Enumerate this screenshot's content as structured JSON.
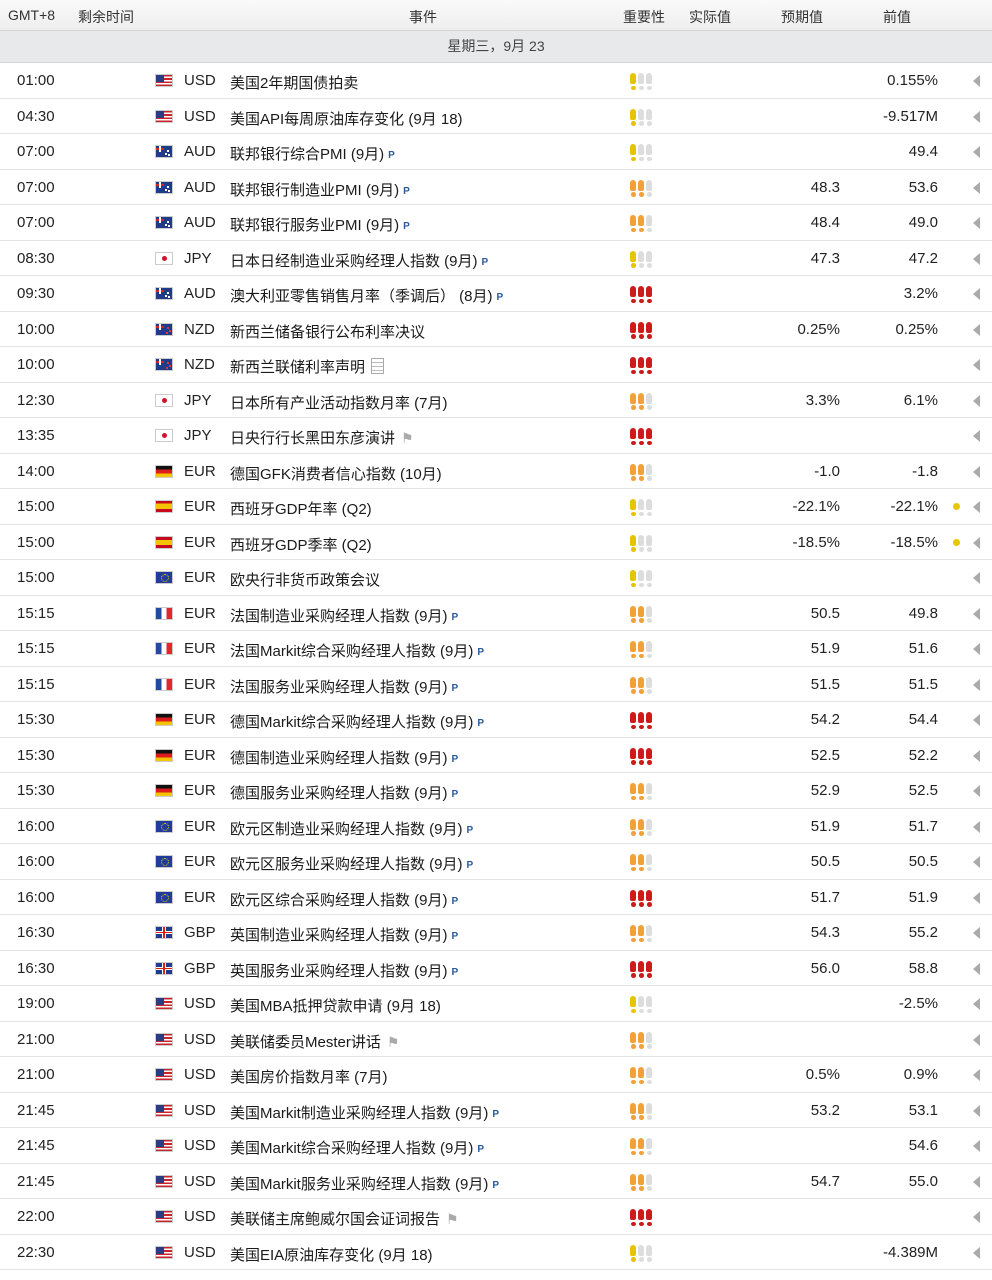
{
  "header": {
    "gmt": "GMT+8",
    "remaining": "剩余时间",
    "event": "事件",
    "importance": "重要性",
    "actual": "实际值",
    "forecast": "预期值",
    "previous": "前值"
  },
  "date": "星期三，9月 23",
  "colors": {
    "imp_low": "#e6c400",
    "imp_med": "#f0a13a",
    "imp_high": "#cc1b1b",
    "imp_empty": "#dddddd"
  },
  "rows": [
    {
      "time": "01:00",
      "flag": "us",
      "cur": "USD",
      "event": "美国2年期国债拍卖",
      "mark": "",
      "imp": 1,
      "forecast": "",
      "prev": "0.155%",
      "dot": false
    },
    {
      "time": "04:30",
      "flag": "us",
      "cur": "USD",
      "event": "美国API每周原油库存变化 (9月 18)",
      "mark": "",
      "imp": 1,
      "forecast": "",
      "prev": "-9.517M",
      "dot": false
    },
    {
      "time": "07:00",
      "flag": "au",
      "cur": "AUD",
      "event": "联邦银行综合PMI (9月)",
      "mark": "p",
      "imp": 1,
      "forecast": "",
      "prev": "49.4",
      "dot": false
    },
    {
      "time": "07:00",
      "flag": "au",
      "cur": "AUD",
      "event": "联邦银行制造业PMI (9月)",
      "mark": "p",
      "imp": 2,
      "forecast": "48.3",
      "prev": "53.6",
      "dot": false
    },
    {
      "time": "07:00",
      "flag": "au",
      "cur": "AUD",
      "event": "联邦银行服务业PMI (9月)",
      "mark": "p",
      "imp": 2,
      "forecast": "48.4",
      "prev": "49.0",
      "dot": false
    },
    {
      "time": "08:30",
      "flag": "jp",
      "cur": "JPY",
      "event": "日本日经制造业采购经理人指数 (9月)",
      "mark": "p",
      "imp": 1,
      "forecast": "47.3",
      "prev": "47.2",
      "dot": false
    },
    {
      "time": "09:30",
      "flag": "au",
      "cur": "AUD",
      "event": "澳大利亚零售销售月率（季调后） (8月)",
      "mark": "p",
      "imp": 3,
      "forecast": "",
      "prev": "3.2%",
      "dot": false
    },
    {
      "time": "10:00",
      "flag": "nz",
      "cur": "NZD",
      "event": "新西兰储备银行公布利率决议",
      "mark": "",
      "imp": 3,
      "forecast": "0.25%",
      "prev": "0.25%",
      "dot": false
    },
    {
      "time": "10:00",
      "flag": "nz",
      "cur": "NZD",
      "event": "新西兰联储利率声明",
      "mark": "doc",
      "imp": 3,
      "forecast": "",
      "prev": "",
      "dot": false
    },
    {
      "time": "12:30",
      "flag": "jp",
      "cur": "JPY",
      "event": "日本所有产业活动指数月率 (7月)",
      "mark": "",
      "imp": 2,
      "forecast": "3.3%",
      "prev": "6.1%",
      "dot": false
    },
    {
      "time": "13:35",
      "flag": "jp",
      "cur": "JPY",
      "event": "日央行行长黑田东彦演讲",
      "mark": "spk",
      "imp": 3,
      "forecast": "",
      "prev": "",
      "dot": false
    },
    {
      "time": "14:00",
      "flag": "de",
      "cur": "EUR",
      "event": "德国GFK消费者信心指数 (10月)",
      "mark": "",
      "imp": 2,
      "forecast": "-1.0",
      "prev": "-1.8",
      "dot": false
    },
    {
      "time": "15:00",
      "flag": "es",
      "cur": "EUR",
      "event": "西班牙GDP年率 (Q2)",
      "mark": "",
      "imp": 1,
      "forecast": "-22.1%",
      "prev": "-22.1%",
      "dot": true
    },
    {
      "time": "15:00",
      "flag": "es",
      "cur": "EUR",
      "event": "西班牙GDP季率 (Q2)",
      "mark": "",
      "imp": 1,
      "forecast": "-18.5%",
      "prev": "-18.5%",
      "dot": true
    },
    {
      "time": "15:00",
      "flag": "eu",
      "cur": "EUR",
      "event": "欧央行非货币政策会议",
      "mark": "",
      "imp": 1,
      "forecast": "",
      "prev": "",
      "dot": false
    },
    {
      "time": "15:15",
      "flag": "fr",
      "cur": "EUR",
      "event": "法国制造业采购经理人指数 (9月)",
      "mark": "p",
      "imp": 2,
      "forecast": "50.5",
      "prev": "49.8",
      "dot": false
    },
    {
      "time": "15:15",
      "flag": "fr",
      "cur": "EUR",
      "event": "法国Markit综合采购经理人指数 (9月)",
      "mark": "p",
      "imp": 2,
      "forecast": "51.9",
      "prev": "51.6",
      "dot": false
    },
    {
      "time": "15:15",
      "flag": "fr",
      "cur": "EUR",
      "event": "法国服务业采购经理人指数 (9月)",
      "mark": "p",
      "imp": 2,
      "forecast": "51.5",
      "prev": "51.5",
      "dot": false
    },
    {
      "time": "15:30",
      "flag": "de",
      "cur": "EUR",
      "event": "德国Markit综合采购经理人指数 (9月)",
      "mark": "p",
      "imp": 3,
      "forecast": "54.2",
      "prev": "54.4",
      "dot": false
    },
    {
      "time": "15:30",
      "flag": "de",
      "cur": "EUR",
      "event": "德国制造业采购经理人指数 (9月)",
      "mark": "p",
      "imp": 3,
      "forecast": "52.5",
      "prev": "52.2",
      "dot": false
    },
    {
      "time": "15:30",
      "flag": "de",
      "cur": "EUR",
      "event": "德国服务业采购经理人指数 (9月)",
      "mark": "p",
      "imp": 2,
      "forecast": "52.9",
      "prev": "52.5",
      "dot": false
    },
    {
      "time": "16:00",
      "flag": "eu",
      "cur": "EUR",
      "event": "欧元区制造业采购经理人指数 (9月)",
      "mark": "p",
      "imp": 2,
      "forecast": "51.9",
      "prev": "51.7",
      "dot": false
    },
    {
      "time": "16:00",
      "flag": "eu",
      "cur": "EUR",
      "event": "欧元区服务业采购经理人指数 (9月)",
      "mark": "p",
      "imp": 2,
      "forecast": "50.5",
      "prev": "50.5",
      "dot": false
    },
    {
      "time": "16:00",
      "flag": "eu",
      "cur": "EUR",
      "event": "欧元区综合采购经理人指数 (9月)",
      "mark": "p",
      "imp": 3,
      "forecast": "51.7",
      "prev": "51.9",
      "dot": false
    },
    {
      "time": "16:30",
      "flag": "gb",
      "cur": "GBP",
      "event": "英国制造业采购经理人指数 (9月)",
      "mark": "p",
      "imp": 2,
      "forecast": "54.3",
      "prev": "55.2",
      "dot": false
    },
    {
      "time": "16:30",
      "flag": "gb",
      "cur": "GBP",
      "event": "英国服务业采购经理人指数 (9月)",
      "mark": "p",
      "imp": 3,
      "forecast": "56.0",
      "prev": "58.8",
      "dot": false
    },
    {
      "time": "19:00",
      "flag": "us",
      "cur": "USD",
      "event": "美国MBA抵押贷款申请 (9月 18)",
      "mark": "",
      "imp": 1,
      "forecast": "",
      "prev": "-2.5%",
      "dot": false
    },
    {
      "time": "21:00",
      "flag": "us",
      "cur": "USD",
      "event": "美联储委员Mester讲话",
      "mark": "spk",
      "imp": 2,
      "forecast": "",
      "prev": "",
      "dot": false
    },
    {
      "time": "21:00",
      "flag": "us",
      "cur": "USD",
      "event": "美国房价指数月率 (7月)",
      "mark": "",
      "imp": 2,
      "forecast": "0.5%",
      "prev": "0.9%",
      "dot": false
    },
    {
      "time": "21:45",
      "flag": "us",
      "cur": "USD",
      "event": "美国Markit制造业采购经理人指数 (9月)",
      "mark": "p",
      "imp": 2,
      "forecast": "53.2",
      "prev": "53.1",
      "dot": false
    },
    {
      "time": "21:45",
      "flag": "us",
      "cur": "USD",
      "event": "美国Markit综合采购经理人指数 (9月)",
      "mark": "p",
      "imp": 2,
      "forecast": "",
      "prev": "54.6",
      "dot": false
    },
    {
      "time": "21:45",
      "flag": "us",
      "cur": "USD",
      "event": "美国Markit服务业采购经理人指数 (9月)",
      "mark": "p",
      "imp": 2,
      "forecast": "54.7",
      "prev": "55.0",
      "dot": false
    },
    {
      "time": "22:00",
      "flag": "us",
      "cur": "USD",
      "event": "美联储主席鲍威尔国会证词报告",
      "mark": "spk",
      "imp": 3,
      "forecast": "",
      "prev": "",
      "dot": false
    },
    {
      "time": "22:30",
      "flag": "us",
      "cur": "USD",
      "event": "美国EIA原油库存变化 (9月 18)",
      "mark": "",
      "imp": 1,
      "forecast": "",
      "prev": "-4.389M",
      "dot": false
    }
  ]
}
